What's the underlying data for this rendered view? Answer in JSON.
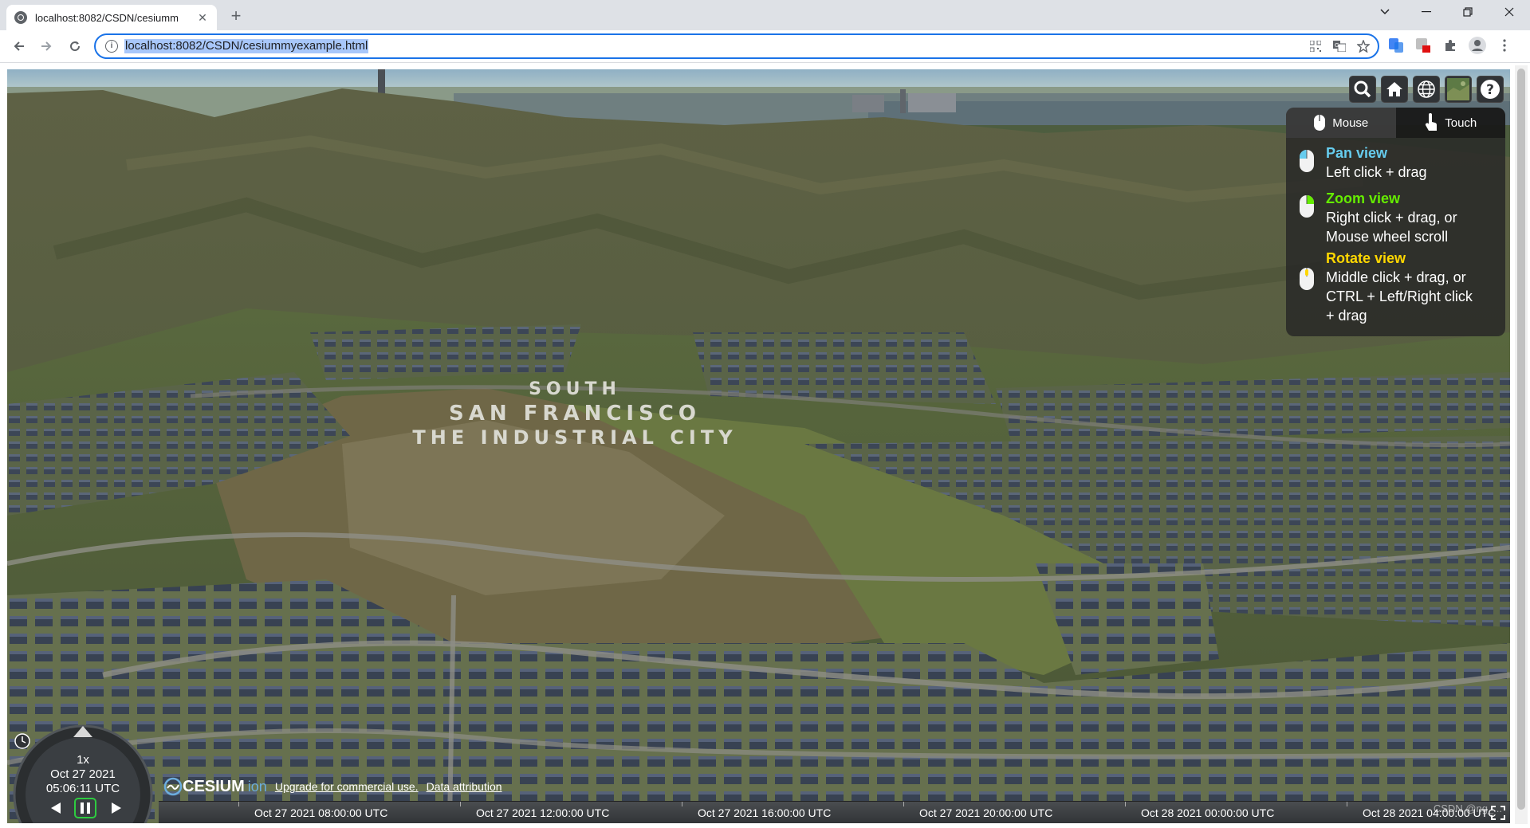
{
  "browser": {
    "tab_title": "localhost:8082/CSDN/cesiumm",
    "tab_close": "✕",
    "new_tab": "+",
    "url": "localhost:8082/CSDN/cesiummyexample.html"
  },
  "navigation_help": {
    "tabs": [
      {
        "label": "Mouse",
        "active": true
      },
      {
        "label": "Touch",
        "active": false
      }
    ],
    "items": [
      {
        "title": "Pan view",
        "title_color": "#66ccee",
        "desc": [
          "Left click + drag"
        ]
      },
      {
        "title": "Zoom view",
        "title_color": "#65ec00",
        "desc": [
          "Right click + drag, or",
          "Mouse wheel scroll"
        ]
      },
      {
        "title": "Rotate view",
        "title_color": "#ffd700",
        "desc": [
          "Middle click + drag, or",
          "CTRL + Left/Right click",
          "+ drag"
        ]
      }
    ]
  },
  "animation": {
    "speed": "1x",
    "date": "Oct 27 2021",
    "time": "05:06:11 UTC"
  },
  "credits": {
    "logo_text": "CESIUM",
    "logo_suffix": "ion",
    "upgrade": "Upgrade for commercial use.",
    "attribution": "Data attribution"
  },
  "timeline": {
    "labels": [
      "Oct 27 2021 08:00:00 UTC",
      "Oct 27 2021 12:00:00 UTC",
      "Oct 27 2021 16:00:00 UTC",
      "Oct 27 2021 20:00:00 UTC",
      "Oct 28 2021 00:00:00 UTC",
      "Oct 28 2021 04:00:00 UTC"
    ]
  },
  "scene": {
    "sign_lines": [
      "SOUTH",
      "SAN FRANCISCO",
      "THE INDUSTRIAL CITY"
    ]
  },
  "watermark": "CSDN @ng_..."
}
